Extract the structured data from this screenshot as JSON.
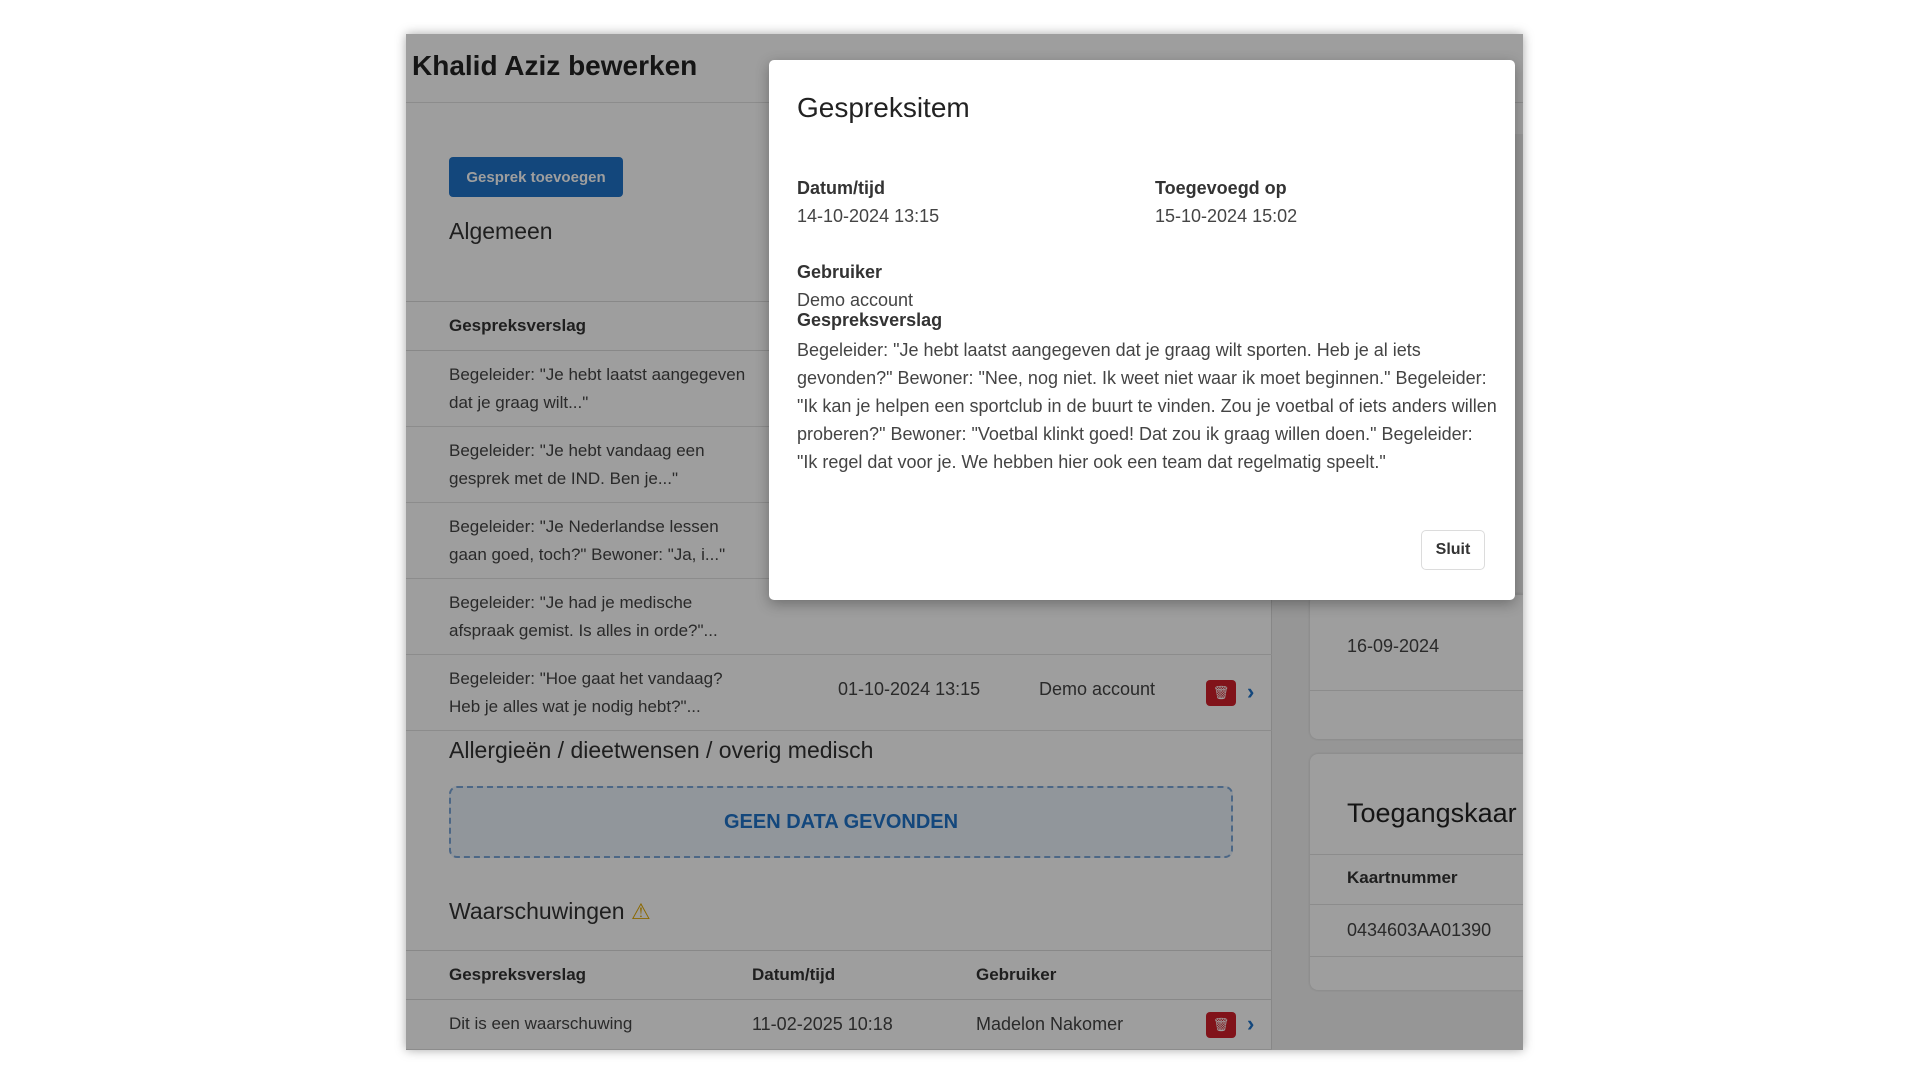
{
  "page": {
    "title": "Khalid Aziz bewerken"
  },
  "conversations": {
    "add_button": "Gesprek toevoegen",
    "heading": "Algemeen",
    "column_report": "Gespreksverslag",
    "rows": [
      {
        "report": "Begeleider: \"Je hebt laatst aangegeven dat je graag wilt...\""
      },
      {
        "report": "Begeleider: \"Je hebt vandaag een gesprek met de IND. Ben je...\""
      },
      {
        "report": "Begeleider: \"Je Nederlandse lessen gaan goed, toch?\" Bewoner: \"Ja, i...\""
      },
      {
        "report": "Begeleider: \"Je had je medische afspraak gemist. Is alles in orde?\"..."
      },
      {
        "report": "Begeleider: \"Hoe gaat het vandaag? Heb je alles wat je nodig hebt?\"...",
        "date": "01-10-2024 13:15",
        "user": "Demo account"
      }
    ]
  },
  "allergies": {
    "heading": "Allergieën / dieetwensen / overig medisch",
    "empty_text": "GEEN DATA GEVONDEN"
  },
  "warnings": {
    "heading": "Waarschuwingen",
    "icon": "warning-icon",
    "columns": [
      "Gespreksverslag",
      "Datum/tijd",
      "Gebruiker"
    ],
    "rows": [
      {
        "report": "Dit is een waarschuwing",
        "date": "11-02-2025 10:18",
        "user": "Madelon Nakomer"
      }
    ]
  },
  "sidebar": {
    "date_value": "16-09-2024",
    "access_card": {
      "heading": "Toegangskaar",
      "column": "Kaartnummer",
      "value": "0434603AA01390"
    }
  },
  "modal": {
    "title": "Gespreksitem",
    "datetime_label": "Datum/tijd",
    "datetime_value": "14-10-2024 13:15",
    "added_label": "Toegevoegd op",
    "added_value": "15-10-2024 15:02",
    "user_label": "Gebruiker",
    "user_value": "Demo account",
    "report_label": "Gespreksverslag",
    "report_text": "Begeleider: \"Je hebt laatst aangegeven dat je graag wilt sporten. Heb je al iets gevonden?\" Bewoner: \"Nee, nog niet. Ik weet niet waar ik moet beginnen.\" Begeleider: \"Ik kan je helpen een sportclub in de buurt te vinden. Zou je voetbal of iets anders willen proberen?\" Bewoner: \"Voetbal klinkt goed! Dat zou ik graag willen doen.\" Begeleider: \"Ik regel dat voor je. We hebben hier ook een team dat regelmatig speelt.\"",
    "close_button": "Sluit"
  },
  "colors": {
    "primary": "#1f73c8",
    "danger": "#d0202a",
    "warning": "#e0a800"
  }
}
